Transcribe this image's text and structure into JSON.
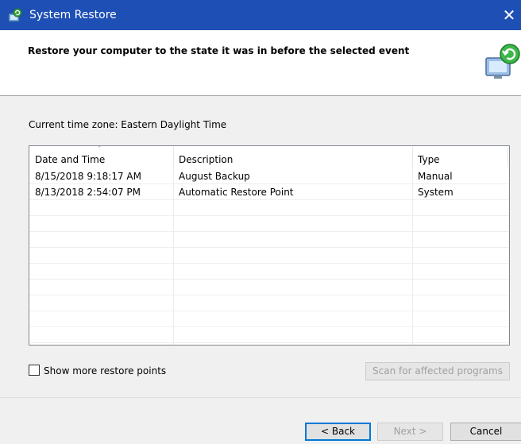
{
  "window": {
    "title": "System Restore",
    "close_glyph": "✕"
  },
  "header": {
    "heading": "Restore your computer to the state it was in before the selected event"
  },
  "timezone": "Current time zone: Eastern Daylight Time",
  "table": {
    "columns": [
      "Date and Time",
      "Description",
      "Type"
    ],
    "sort_glyph": "ˇ",
    "rows": [
      [
        "8/15/2018 9:18:17 AM",
        "August Backup",
        "Manual"
      ],
      [
        "8/13/2018 2:54:07 PM",
        "Automatic Restore Point",
        "System"
      ]
    ]
  },
  "checkbox": {
    "label": "Show more restore points",
    "checked": false
  },
  "buttons": {
    "scan": "Scan for affected programs",
    "back": "< Back",
    "next": "Next >",
    "cancel": "Cancel"
  },
  "colors": {
    "titlebar": "#1e4fb5",
    "accent": "#0078d7"
  }
}
